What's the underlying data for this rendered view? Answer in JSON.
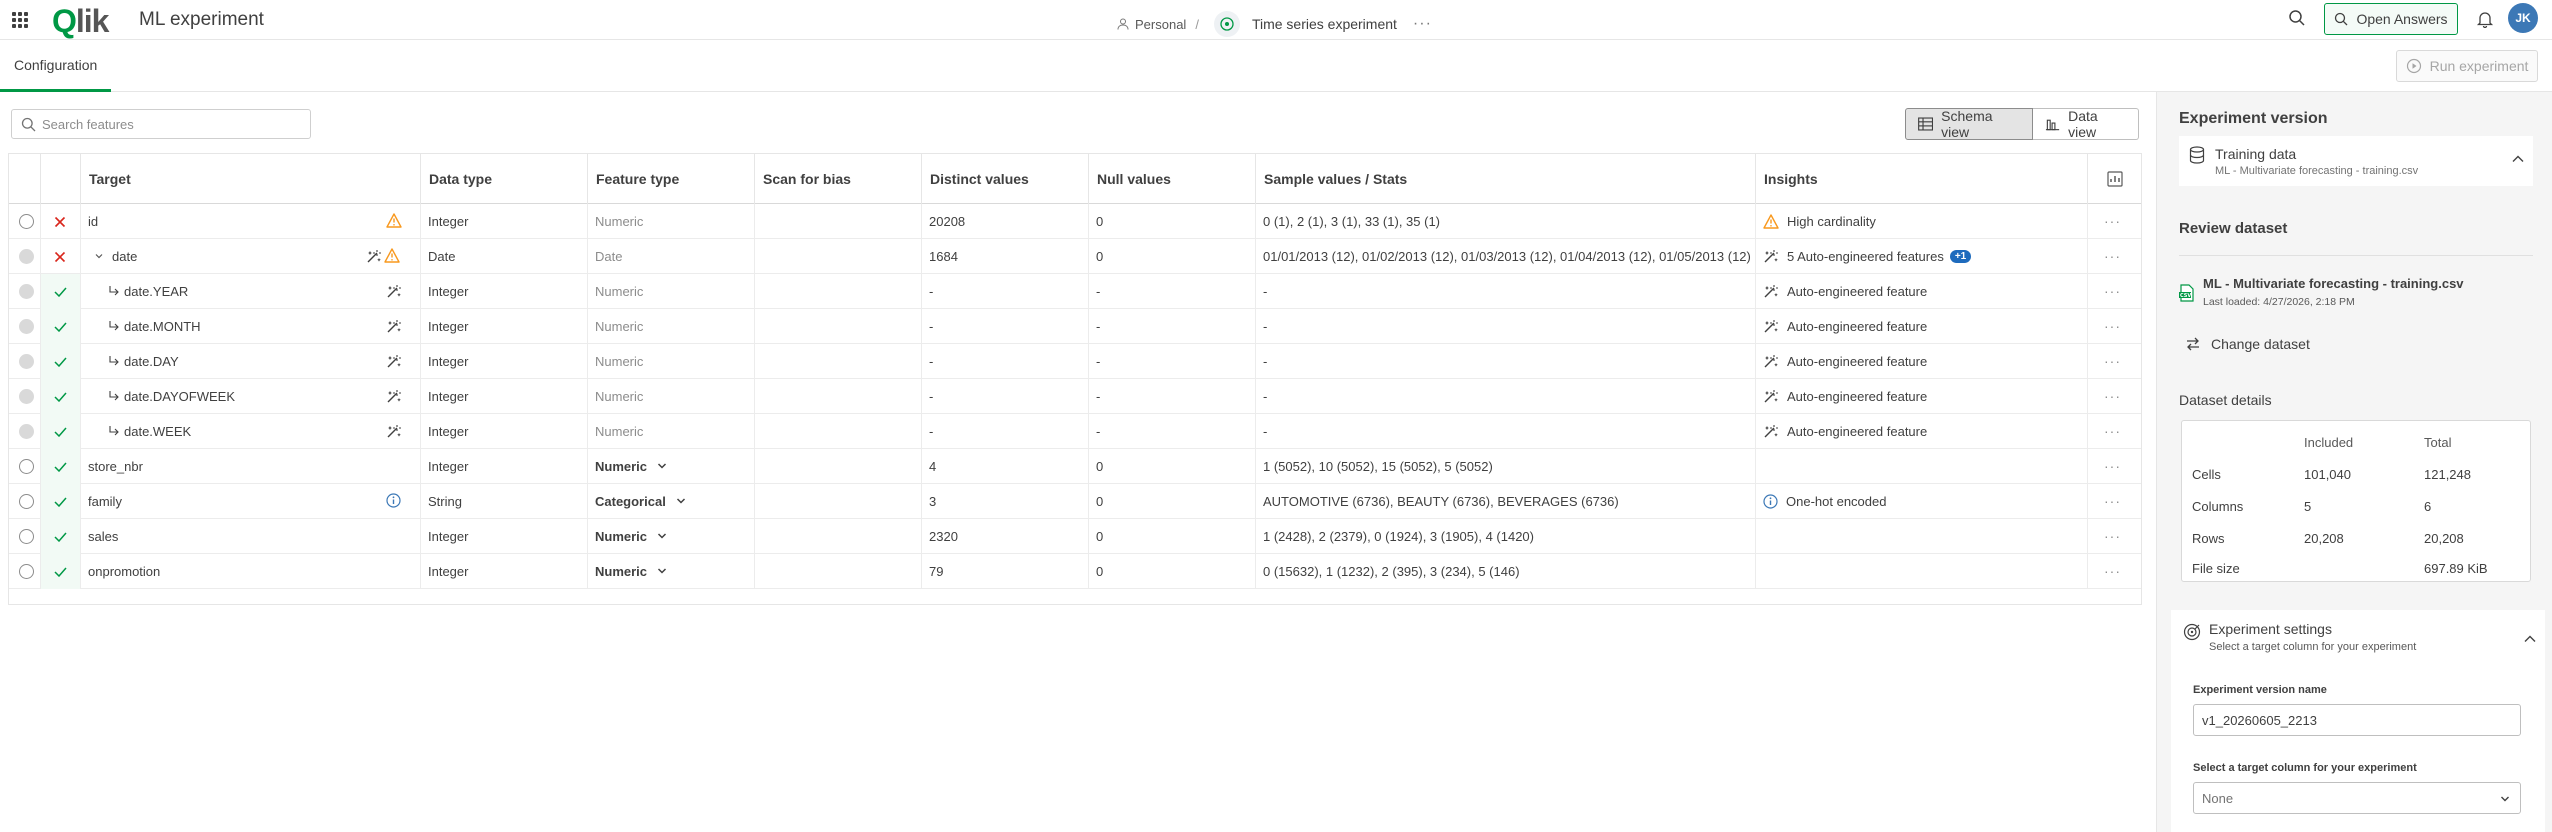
{
  "header": {
    "logo_text": "Qlik",
    "app_title": "ML experiment",
    "space": "Personal",
    "separator": "/",
    "experiment_name": "Time series experiment",
    "more": "···",
    "open_answers": "Open Answers",
    "user_initials": "JK"
  },
  "tabs": {
    "configuration": "Configuration",
    "run_experiment": "Run experiment"
  },
  "search": {
    "placeholder": "Search features"
  },
  "views": {
    "schema": "Schema view",
    "data": "Data view"
  },
  "table": {
    "columns": [
      "Target",
      "Data type",
      "Feature type",
      "Scan for bias",
      "Distinct values",
      "Null values",
      "Sample values / Stats",
      "Insights"
    ],
    "rows": [
      {
        "name": "id",
        "status": "excluded",
        "indent": 0,
        "icon": "warning-icon",
        "data_type": "Integer",
        "feature_type": "Numeric",
        "ft_style": "muted",
        "distinct": "20208",
        "nulls": "0",
        "samples": "0 (1), 2 (1), 3 (1), 33 (1), 35 (1)",
        "insight": "High cardinality",
        "insight_icon": "warning-icon"
      },
      {
        "name": "date",
        "status": "excluded",
        "indent": 1,
        "icon": "auto-engineer-warning-icon",
        "data_type": "Date",
        "feature_type": "Date",
        "ft_style": "muted",
        "distinct": "1684",
        "nulls": "0",
        "samples": "01/01/2013 (12), 01/02/2013 (12), 01/03/2013 (12), 01/04/2013 (12), 01/05/2013 (12)",
        "insight": "5 Auto-engineered features",
        "insight_icon": "auto-engineer-icon",
        "badge": "+1"
      },
      {
        "name": "date.YEAR",
        "status": "included",
        "indent": 2,
        "icon": "auto-engineer-icon",
        "data_type": "Integer",
        "feature_type": "Numeric",
        "ft_style": "muted",
        "distinct": "-",
        "nulls": "-",
        "samples": "-",
        "insight": "Auto-engineered feature",
        "insight_icon": "auto-engineer-icon"
      },
      {
        "name": "date.MONTH",
        "status": "included",
        "indent": 2,
        "icon": "auto-engineer-icon",
        "data_type": "Integer",
        "feature_type": "Numeric",
        "ft_style": "muted",
        "distinct": "-",
        "nulls": "-",
        "samples": "-",
        "insight": "Auto-engineered feature",
        "insight_icon": "auto-engineer-icon"
      },
      {
        "name": "date.DAY",
        "status": "included",
        "indent": 2,
        "icon": "auto-engineer-icon",
        "data_type": "Integer",
        "feature_type": "Numeric",
        "ft_style": "muted",
        "distinct": "-",
        "nulls": "-",
        "samples": "-",
        "insight": "Auto-engineered feature",
        "insight_icon": "auto-engineer-icon"
      },
      {
        "name": "date.DAYOFWEEK",
        "status": "included",
        "indent": 2,
        "icon": "auto-engineer-icon",
        "data_type": "Integer",
        "feature_type": "Numeric",
        "ft_style": "muted",
        "distinct": "-",
        "nulls": "-",
        "samples": "-",
        "insight": "Auto-engineered feature",
        "insight_icon": "auto-engineer-icon"
      },
      {
        "name": "date.WEEK",
        "status": "included",
        "indent": 2,
        "icon": "auto-engineer-icon",
        "data_type": "Integer",
        "feature_type": "Numeric",
        "ft_style": "muted",
        "distinct": "-",
        "nulls": "-",
        "samples": "-",
        "insight": "Auto-engineered feature",
        "insight_icon": "auto-engineer-icon"
      },
      {
        "name": "store_nbr",
        "status": "included",
        "indent": 0,
        "icon": "",
        "data_type": "Integer",
        "feature_type": "Numeric",
        "ft_style": "dropdown",
        "distinct": "4",
        "nulls": "0",
        "samples": "1 (5052), 10 (5052), 15 (5052), 5 (5052)",
        "insight": "",
        "insight_icon": ""
      },
      {
        "name": "family",
        "status": "included",
        "indent": 0,
        "icon": "info-icon",
        "data_type": "String",
        "feature_type": "Categorical",
        "ft_style": "dropdown",
        "distinct": "3",
        "nulls": "0",
        "samples": "AUTOMOTIVE (6736), BEAUTY (6736), BEVERAGES (6736)",
        "insight": "One-hot encoded",
        "insight_icon": "info-icon"
      },
      {
        "name": "sales",
        "status": "included",
        "indent": 0,
        "icon": "",
        "data_type": "Integer",
        "feature_type": "Numeric",
        "ft_style": "dropdown",
        "distinct": "2320",
        "nulls": "0",
        "samples": "1 (2428), 2 (2379), 0 (1924), 3 (1905), 4 (1420)",
        "insight": "",
        "insight_icon": ""
      },
      {
        "name": "onpromotion",
        "status": "included",
        "indent": 0,
        "icon": "",
        "data_type": "Integer",
        "feature_type": "Numeric",
        "ft_style": "dropdown",
        "distinct": "79",
        "nulls": "0",
        "samples": "0 (15632), 1 (1232), 2 (395), 3 (234), 5 (146)",
        "insight": "",
        "insight_icon": ""
      }
    ]
  },
  "panel": {
    "title": "Experiment version",
    "training_title": "Training data",
    "training_file": "ML - Multivariate forecasting - training.csv",
    "review_heading": "Review dataset",
    "dataset_name": "ML - Multivariate forecasting - training.csv",
    "dataset_loaded": "Last loaded: 4/27/2026, 2:18 PM",
    "change_dataset": "Change dataset",
    "details_heading": "Dataset details",
    "details": {
      "col_included": "Included",
      "col_total": "Total",
      "rows": [
        {
          "label": "Cells",
          "included": "101,040",
          "total": "121,248"
        },
        {
          "label": "Columns",
          "included": "5",
          "total": "6"
        },
        {
          "label": "Rows",
          "included": "20,208",
          "total": "20,208"
        },
        {
          "label": "File size",
          "included": "",
          "total": "697.89 KiB"
        }
      ]
    },
    "settings_title": "Experiment settings",
    "settings_sub": "Select a target column for your experiment",
    "version_name_label": "Experiment version name",
    "version_name_value": "v1_20260605_2213",
    "target_label": "Select a target column for your experiment",
    "target_value": "None"
  },
  "colors": {
    "accent": "#009845",
    "excluded": "#d9261c",
    "warning": "#f8981d",
    "info": "#3c78b6"
  }
}
